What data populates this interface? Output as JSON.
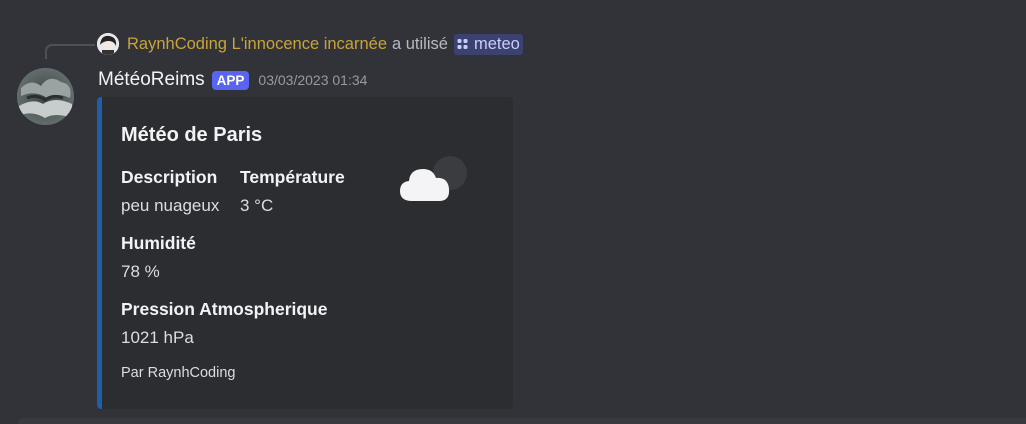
{
  "interaction": {
    "username": "RaynhCoding L'innocence incarnée",
    "used_text": "a utilisé",
    "command": "meteo",
    "command_icon": "slash-command-icon"
  },
  "message": {
    "author": "MétéoReims",
    "badge": "APP",
    "timestamp": "03/03/2023 01:34"
  },
  "embed": {
    "accent_color": "#1e5fa8",
    "title": "Météo de Paris",
    "thumbnail_icon": "partly-cloudy-icon",
    "fields": [
      {
        "name": "Description",
        "value": "peu nuageux"
      },
      {
        "name": "Température",
        "value": "3 °C"
      },
      {
        "name": "Humidité",
        "value": "78 %"
      },
      {
        "name": "Pression Atmospherique",
        "value": "1021 hPa"
      }
    ],
    "footer": "Par RaynhCoding"
  }
}
